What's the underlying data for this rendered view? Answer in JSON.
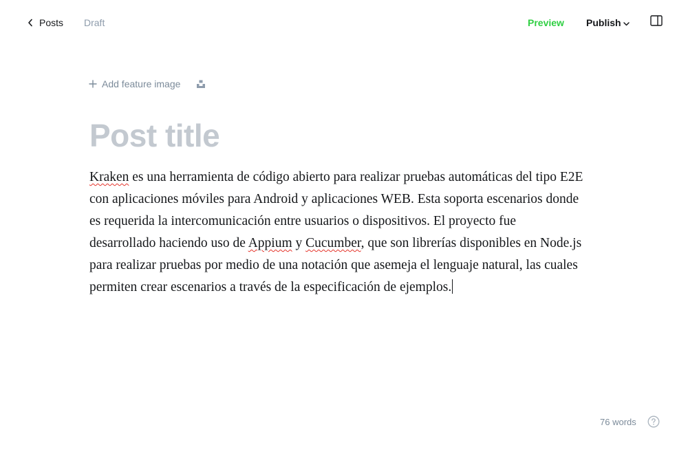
{
  "header": {
    "back_label": "Posts",
    "status": "Draft",
    "preview_label": "Preview",
    "publish_label": "Publish"
  },
  "editor": {
    "add_feature_image_label": "Add feature image",
    "title_placeholder": "Post title",
    "body": {
      "seg1": "Kraken",
      "seg2": " es una herramienta de código abierto para realizar pruebas automáticas del tipo E2E con aplicaciones móviles para Android y aplicaciones WEB. Esta soporta escenarios donde es requerida la intercomunicación entre usuarios o dispositivos. El proyecto fue desarrollado haciendo uso de ",
      "seg3": "Appium",
      "seg4": " y ",
      "seg5": "Cucumber",
      "seg6": ", que son librerías disponibles en Node.js para realizar pruebas por medio de una notación que asemeja el lenguaje natural, las cuales permiten crear escenarios a través de la especificación de ejemplos."
    }
  },
  "footer": {
    "word_count": "76 words"
  },
  "colors": {
    "accent_green": "#30cf43",
    "muted_text": "#8e9cac",
    "title_placeholder": "#c3c9d0",
    "spell_error": "#e5342a"
  },
  "icons": {
    "back": "chevron-left-icon",
    "publish_caret": "chevron-down-icon",
    "sidebar": "sidebar-toggle-icon",
    "add": "plus-icon",
    "unsplash": "unsplash-icon",
    "help": "question-circle-icon"
  }
}
